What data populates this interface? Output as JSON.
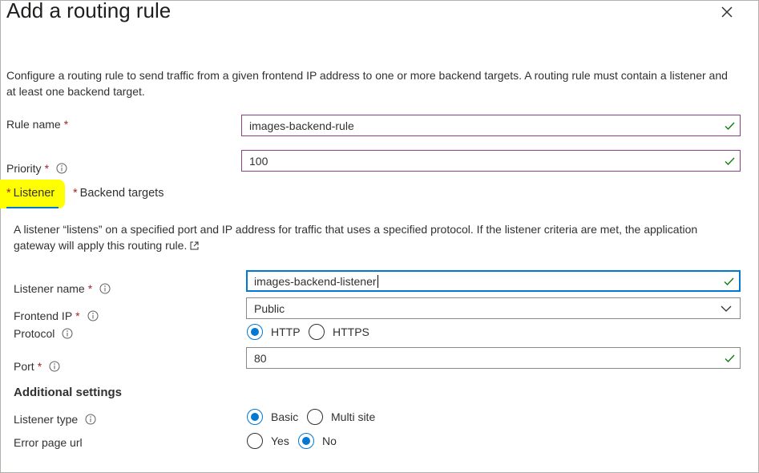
{
  "dialog": {
    "title": "Add a routing rule",
    "description": "Configure a routing rule to send traffic from a given frontend IP address to one or more backend targets. A routing rule must contain a listener and at least one backend target."
  },
  "rule_name": {
    "label": "Rule name",
    "required_mark": "*",
    "value": "images-backend-rule",
    "valid": true
  },
  "priority": {
    "label": "Priority",
    "required_mark": "*",
    "value": "100",
    "valid": true
  },
  "tabs": [
    {
      "label": "Listener",
      "required_mark": "*",
      "selected": true,
      "highlight_color": "#ffff00"
    },
    {
      "label": "Backend targets",
      "required_mark": "*",
      "selected": false
    }
  ],
  "listener": {
    "description": "A listener “listens” on a specified port and IP address for traffic that uses a specified protocol. If the listener criteria are met, the application gateway will apply this routing rule.",
    "listener_name": {
      "label": "Listener name",
      "required_mark": "*",
      "value": "images-backend-listener",
      "valid": true,
      "focused": true
    },
    "frontend_ip": {
      "label": "Frontend IP",
      "required_mark": "*",
      "selected": "Public"
    },
    "protocol": {
      "label": "Protocol",
      "options": [
        "HTTP",
        "HTTPS"
      ],
      "selected": "HTTP"
    },
    "port": {
      "label": "Port",
      "required_mark": "*",
      "value": "80",
      "valid": true
    }
  },
  "additional_settings": {
    "heading": "Additional settings",
    "listener_type": {
      "label": "Listener type",
      "options": [
        "Basic",
        "Multi site"
      ],
      "selected": "Basic"
    },
    "error_page_url": {
      "label": "Error page url",
      "options": [
        "Yes",
        "No"
      ],
      "selected": "No"
    }
  },
  "colors": {
    "accent": "#0078d4",
    "valid_check": "#107c10",
    "required": "#a4262c",
    "input_border": "#8a3f87"
  },
  "icons": [
    "close-icon",
    "info-icon",
    "checkmark-icon",
    "chevron-down-icon",
    "external-link-icon"
  ]
}
